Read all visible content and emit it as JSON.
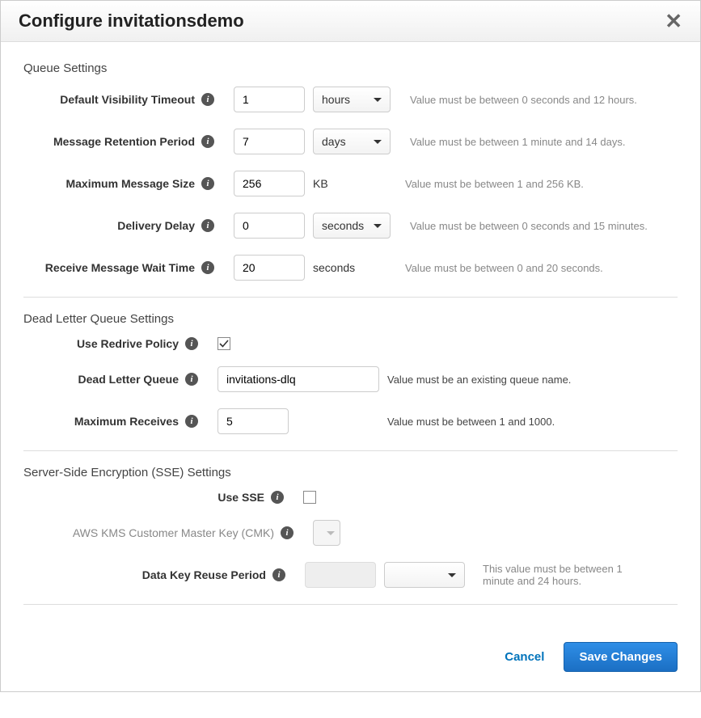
{
  "dialog": {
    "title": "Configure invitationsdemo",
    "close_glyph": "✕"
  },
  "queue": {
    "section_title": "Queue Settings",
    "visibility": {
      "label": "Default Visibility Timeout",
      "value": "1",
      "unit": "hours",
      "hint": "Value must be between 0 seconds and 12 hours."
    },
    "retention": {
      "label": "Message Retention Period",
      "value": "7",
      "unit": "days",
      "hint": "Value must be between 1 minute and 14 days."
    },
    "max_size": {
      "label": "Maximum Message Size",
      "value": "256",
      "unit": "KB",
      "hint": "Value must be between 1 and 256 KB."
    },
    "delay": {
      "label": "Delivery Delay",
      "value": "0",
      "unit": "seconds",
      "hint": "Value must be between 0 seconds and 15 minutes."
    },
    "wait_time": {
      "label": "Receive Message Wait Time",
      "value": "20",
      "unit": "seconds",
      "hint": "Value must be between 0 and 20 seconds."
    }
  },
  "dlq": {
    "section_title": "Dead Letter Queue Settings",
    "redrive": {
      "label": "Use Redrive Policy",
      "checked": true
    },
    "queue_name": {
      "label": "Dead Letter Queue",
      "value": "invitations-dlq",
      "hint": "Value must be an existing queue name."
    },
    "max_receives": {
      "label": "Maximum Receives",
      "value": "5",
      "hint": "Value must be between 1 and 1000."
    }
  },
  "sse": {
    "section_title": "Server-Side Encryption (SSE) Settings",
    "use_sse": {
      "label": "Use SSE",
      "checked": false
    },
    "cmk": {
      "label": "AWS KMS Customer Master Key (CMK)"
    },
    "reuse": {
      "label": "Data Key Reuse Period",
      "hint": "This value must be between 1 minute and 24 hours."
    }
  },
  "footer": {
    "cancel": "Cancel",
    "save": "Save Changes"
  },
  "info_glyph": "i"
}
